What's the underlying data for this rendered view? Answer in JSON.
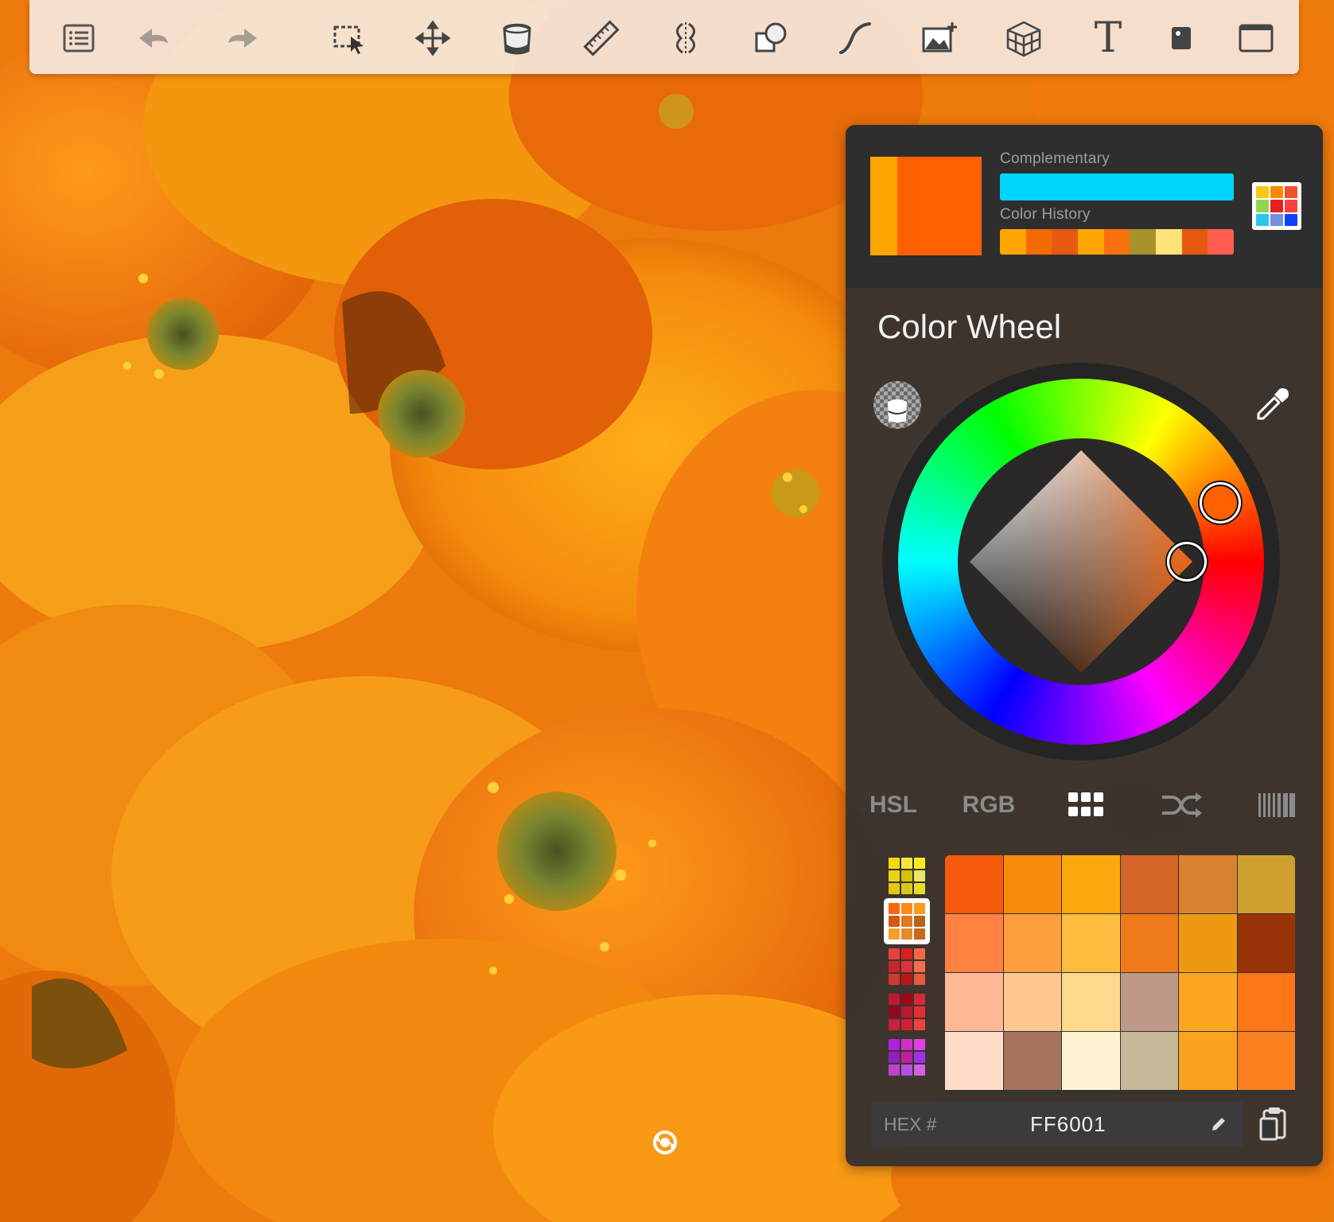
{
  "toolbar": {
    "tools": [
      {
        "id": "tool-list",
        "icon": "list-icon"
      },
      {
        "id": "tool-undo",
        "icon": "undo-icon"
      },
      {
        "id": "tool-redo",
        "icon": "redo-icon"
      },
      {
        "id": "tool-select",
        "icon": "selection-icon"
      },
      {
        "id": "tool-transform",
        "icon": "move-icon"
      },
      {
        "id": "tool-fill",
        "icon": "paint-bucket-icon"
      },
      {
        "id": "tool-ruler",
        "icon": "ruler-icon"
      },
      {
        "id": "tool-symmetry",
        "icon": "symmetry-icon"
      },
      {
        "id": "tool-shapes",
        "icon": "shapes-icon"
      },
      {
        "id": "tool-stroke",
        "icon": "curve-icon"
      },
      {
        "id": "tool-image",
        "icon": "add-image-icon"
      },
      {
        "id": "tool-perspective",
        "icon": "perspective-grid-icon"
      },
      {
        "id": "tool-text",
        "icon": "text-icon",
        "label": "T"
      },
      {
        "id": "tool-layer",
        "icon": "layer-icon"
      },
      {
        "id": "tool-fullscreen",
        "icon": "fullscreen-icon"
      }
    ]
  },
  "color_panel": {
    "current_color": "#FF6001",
    "previous_color": "#FFA500",
    "complementary_label": "Complementary",
    "complementary_color": "#00D4FF",
    "history_label": "Color History",
    "history": [
      "#FFA500",
      "#F26B00",
      "#E85A10",
      "#FFA500",
      "#F97210",
      "#A8922A",
      "#FFE27A",
      "#E45A10",
      "#FF5E50"
    ],
    "palette_button_colors": [
      "#F6C81A",
      "#FF8A00",
      "#F0502A",
      "#8ED64E",
      "#E52020",
      "#FF4040",
      "#2EC4F0",
      "#7090E0",
      "#1040FF"
    ],
    "title": "Color Wheel",
    "wheel": {
      "hue_deg": 23,
      "saturation": 1.0,
      "value": 1.0
    },
    "mode_tabs": {
      "hsl": "HSL",
      "rgb": "RGB",
      "swatches_icon": "grid-icon",
      "harmony_icon": "shuffle-icon",
      "copic_icon": "barcode-icon",
      "active": "swatches"
    },
    "palettes": [
      [
        "#F4D80A",
        "#F2E640",
        "#F5EC1A",
        "#E8D412",
        "#D6C008",
        "#EAE66A",
        "#E2C810",
        "#D8C81A",
        "#E8DC2A"
      ],
      [
        "#F46A0A",
        "#FF8A18",
        "#F99A1A",
        "#D25A18",
        "#E07820",
        "#B8621A",
        "#F2A030",
        "#E58A2A",
        "#C86A18"
      ],
      [
        "#E84040",
        "#D82020",
        "#F06A48",
        "#C82828",
        "#E03040",
        "#F27050",
        "#D03830",
        "#B81818",
        "#E85A40"
      ],
      [
        "#C01830",
        "#A00818",
        "#D82838",
        "#900820",
        "#B81830",
        "#E03030",
        "#C82040",
        "#D02030",
        "#F04040"
      ],
      [
        "#B020E0",
        "#D030C8",
        "#E040E0",
        "#9020C0",
        "#C020A0",
        "#A030E8",
        "#C040D0",
        "#B050E0",
        "#D060E0"
      ]
    ],
    "selected_palette_index": 1,
    "swatches": [
      "#F65A0A",
      "#F98A0A",
      "#FBA90C",
      "#D26428",
      "#D7822E",
      "#CFA030",
      "#FF8242",
      "#FF9E3F",
      "#FFBC3E",
      "#EF7A1A",
      "#EE9A10",
      "#983308",
      "#FFB895",
      "#FFC790",
      "#FFD98E",
      "#C09A88",
      "#FBA520",
      "#FF7618",
      "#FFDCC6",
      "#A5735E",
      "#FFF2D2",
      "#C6B798",
      "#FBA21E",
      "#FA8020"
    ],
    "hex_label": "HEX #",
    "hex_value": "FF6001"
  }
}
